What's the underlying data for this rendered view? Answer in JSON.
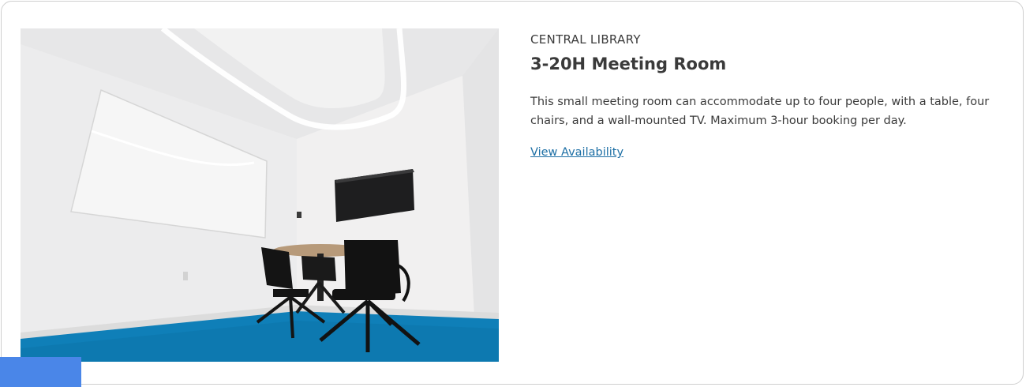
{
  "room": {
    "location": "CENTRAL LIBRARY",
    "title": "3-20H Meeting Room",
    "description": "This small meeting room can accommodate up to four people, with a table, four chairs, and a wall-mounted TV. Maximum 3-hour booking per day.",
    "link_label": "View Availability",
    "photo_icon": "meeting-room-photo"
  },
  "colors": {
    "link": "#1d6fa5",
    "accent_tab": "#4a86e8",
    "carpet": "#0f7fb8",
    "border": "#cfcfcf"
  }
}
